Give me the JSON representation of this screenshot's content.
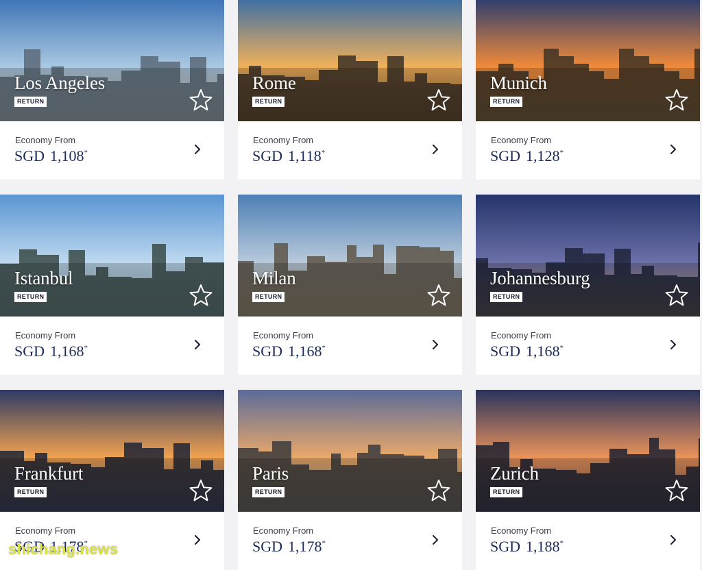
{
  "common": {
    "economy_label": "Economy From",
    "currency": "SGD",
    "asterisk": "*",
    "return_badge": "RETURN"
  },
  "destinations": [
    {
      "city": "Los Angeles",
      "price": "1,108",
      "palette": [
        "#3f74b6",
        "#a9c8e2",
        "#c9b58d",
        "#5a6a78"
      ]
    },
    {
      "city": "Rome",
      "price": "1,118",
      "palette": [
        "#3e6fa3",
        "#f0b05a",
        "#8c5a34",
        "#3b3026"
      ]
    },
    {
      "city": "Munich",
      "price": "1,128",
      "palette": [
        "#2e3f6e",
        "#f08a3a",
        "#c79a5e",
        "#3e3324"
      ]
    },
    {
      "city": "Istanbul",
      "price": "1,168",
      "palette": [
        "#5b95d3",
        "#bcd8ee",
        "#8aa4b6",
        "#3a4a46"
      ]
    },
    {
      "city": "Milan",
      "price": "1,168",
      "palette": [
        "#4e7fb6",
        "#b7c9da",
        "#b9aa8f",
        "#5d5548"
      ]
    },
    {
      "city": "Johannesburg",
      "price": "1,168",
      "palette": [
        "#24346a",
        "#6b6fa8",
        "#d7a35b",
        "#1e2438"
      ]
    },
    {
      "city": "Frankfurt",
      "price": "1,178",
      "palette": [
        "#2b3a66",
        "#f0a150",
        "#6d6f86",
        "#1d2335"
      ]
    },
    {
      "city": "Paris",
      "price": "1,178",
      "palette": [
        "#5a6b9a",
        "#e8a86a",
        "#8f8474",
        "#3a3a3c"
      ]
    },
    {
      "city": "Zurich",
      "price": "1,188",
      "palette": [
        "#28335e",
        "#e9925a",
        "#6d5a52",
        "#1c2131"
      ]
    }
  ],
  "watermark": "shichang.news"
}
